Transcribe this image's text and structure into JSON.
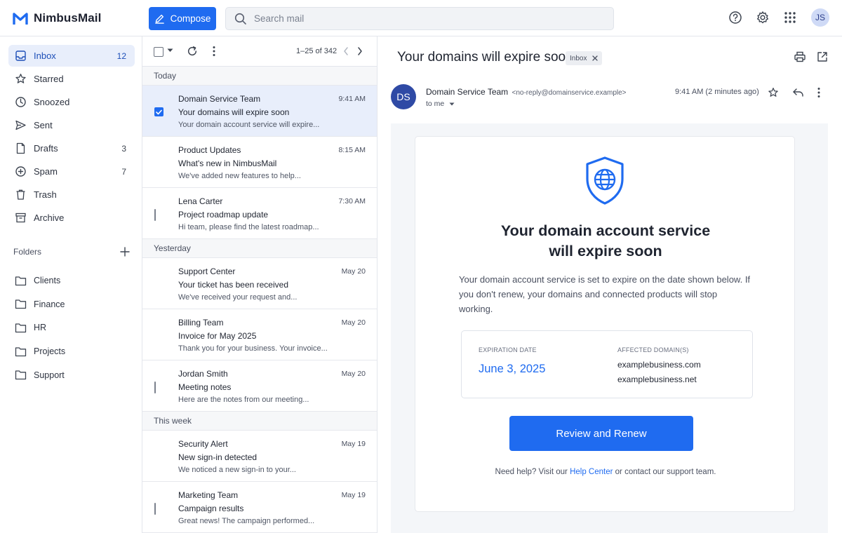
{
  "app": {
    "name": "NimbusMail"
  },
  "header": {
    "compose_label": "Compose",
    "search_placeholder": "Search mail",
    "user_initials": "JS"
  },
  "sidebar": {
    "items": [
      {
        "label": "Inbox",
        "count": "12",
        "icon": "inbox-icon"
      },
      {
        "label": "Starred",
        "count": "",
        "icon": "star-icon"
      },
      {
        "label": "Snoozed",
        "count": "",
        "icon": "clock-icon"
      },
      {
        "label": "Sent",
        "count": "",
        "icon": "send-icon"
      },
      {
        "label": "Drafts",
        "count": "3",
        "icon": "draft-icon"
      },
      {
        "label": "Spam",
        "count": "7",
        "icon": "spam-icon"
      },
      {
        "label": "Trash",
        "count": "",
        "icon": "trash-icon"
      },
      {
        "label": "Archive",
        "count": "",
        "icon": "archive-icon"
      }
    ],
    "folders_title": "Folders",
    "folders": [
      "Clients",
      "Finance",
      "HR",
      "Projects",
      "Support"
    ]
  },
  "list": {
    "range": "1–25 of 342",
    "groups": [
      {
        "label": "Today",
        "messages": [
          {
            "sender": "Domain Service Team",
            "time": "9:41 AM",
            "subject": "Your domains will expire soon",
            "snippet": "Your domain account service will expire...",
            "state": "checked"
          },
          {
            "sender": "Product Updates",
            "time": "8:15 AM",
            "subject": "What's new in NimbusMail",
            "snippet": "We've added new features to help...",
            "state": "unread"
          },
          {
            "sender": "Lena Carter",
            "time": "7:30 AM",
            "subject": "Project roadmap update",
            "snippet": "Hi team, please find the latest roadmap...",
            "state": "read"
          }
        ]
      },
      {
        "label": "Yesterday",
        "messages": [
          {
            "sender": "Support Center",
            "time": "May 20",
            "subject": "Your ticket has been received",
            "snippet": "We've received your request and...",
            "state": "unread"
          },
          {
            "sender": "Billing Team",
            "time": "May 20",
            "subject": "Invoice for May 2025",
            "snippet": "Thank you for your business. Your invoice...",
            "state": "unread"
          },
          {
            "sender": "Jordan Smith",
            "time": "May 20",
            "subject": "Meeting notes",
            "snippet": "Here are the notes from our meeting...",
            "state": "read"
          }
        ]
      },
      {
        "label": "This week",
        "messages": [
          {
            "sender": "Security Alert",
            "time": "May 19",
            "subject": "New sign-in detected",
            "snippet": "We noticed a new sign-in to your...",
            "state": "unread"
          },
          {
            "sender": "Marketing Team",
            "time": "May 19",
            "subject": "Campaign results",
            "snippet": "Great news! The campaign performed...",
            "state": "read"
          }
        ]
      }
    ]
  },
  "reader": {
    "subject": "Your domains will expire soon",
    "tag": "Inbox",
    "avatar_initials": "DS",
    "from_name": "Domain Service Team",
    "from_address": "<no-reply@domainservice.example>",
    "to": "to me",
    "time": "9:41 AM (2 minutes ago)",
    "body": {
      "heading_line1": "Your domain account service",
      "heading_line2": "will expire soon",
      "paragraph": "Your domain account service is set to expire on the date shown below. If you don't renew, your domains and connected products will stop working.",
      "expiration_label": "EXPIRATION DATE",
      "expiration_date": "June 3, 2025",
      "domains_label": "AFFECTED DOMAIN(S)",
      "domains": [
        "examplebusiness.com",
        "examplebusiness.net"
      ],
      "button_label": "Review and Renew",
      "help_prefix": "Need help? Visit our ",
      "help_link": "Help Center",
      "help_suffix": " or contact our support team."
    }
  },
  "colors": {
    "accent": "#1f6bf0",
    "selected_bg": "#e8eefb",
    "avatar_ds": "#2f4aa5"
  }
}
